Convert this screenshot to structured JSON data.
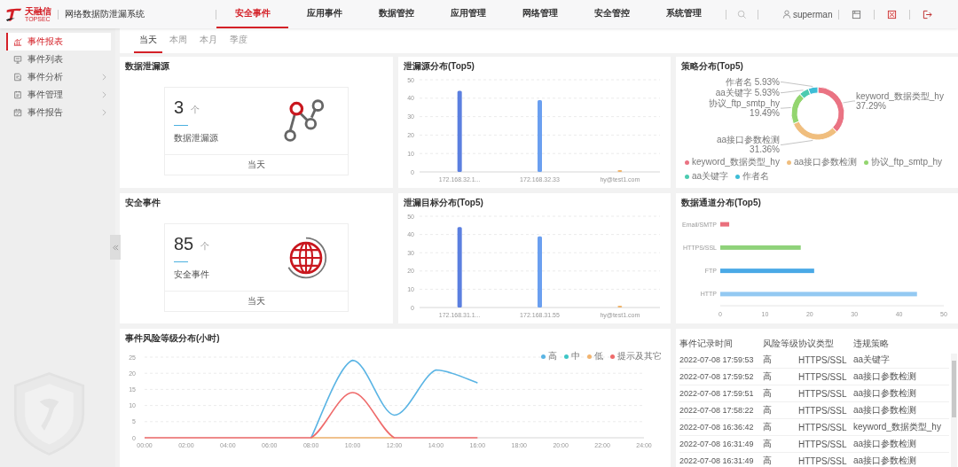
{
  "header": {
    "brand": "天融信",
    "brand_en": "TOPSEC",
    "system_name": "网络数据防泄漏系统",
    "nav": [
      {
        "label": "安全事件",
        "selected": true
      },
      {
        "label": "应用事件",
        "selected": false
      },
      {
        "label": "数据管控",
        "selected": false
      },
      {
        "label": "应用管理",
        "selected": false
      },
      {
        "label": "网络管理",
        "selected": false
      },
      {
        "label": "安全管控",
        "selected": false
      },
      {
        "label": "系统管理",
        "selected": false
      }
    ],
    "user": "superman"
  },
  "sidebar": {
    "items": [
      {
        "label": "事件报表",
        "selected": true,
        "expandable": false
      },
      {
        "label": "事件列表",
        "selected": false,
        "expandable": false
      },
      {
        "label": "事件分析",
        "selected": false,
        "expandable": true
      },
      {
        "label": "事件管理",
        "selected": false,
        "expandable": true
      },
      {
        "label": "事件报告",
        "selected": false,
        "expandable": true
      }
    ]
  },
  "period_tabs": [
    {
      "label": "当天",
      "selected": true
    },
    {
      "label": "本周",
      "selected": false
    },
    {
      "label": "本月",
      "selected": false
    },
    {
      "label": "季度",
      "selected": false
    }
  ],
  "stat_cards": [
    {
      "title": "数据泄漏源",
      "value": "3",
      "unit": "个",
      "label": "数据泄漏源",
      "footer": "当天"
    },
    {
      "title": "安全事件",
      "value": "85",
      "unit": "个",
      "label": "安全事件",
      "footer": "当天"
    }
  ],
  "leak_source": {
    "title": "泄漏源分布(Top5)",
    "chart_data": {
      "type": "bar",
      "categories": [
        "172.168.32.1...",
        "172.168.32.33",
        "hy@test1.com"
      ],
      "values": [
        44,
        39,
        1
      ],
      "colors": [
        "#5b7fe0",
        "#6a9ff0",
        "#f0b46a"
      ],
      "ylim": [
        0,
        50
      ],
      "yticks": [
        0,
        10,
        20,
        30,
        40,
        50
      ],
      "grid": true
    }
  },
  "policy": {
    "title": "策略分布(Top5)",
    "chart_data": {
      "type": "donut",
      "categories": [
        "keyword_数据类型_hy",
        "aa接口参数检测",
        "协议_ftp_smtp_hy",
        "aa关键字",
        "作者名"
      ],
      "values": [
        37.29,
        31.36,
        19.49,
        5.93,
        5.93
      ],
      "colors": [
        "#ea7383",
        "#f0be7e",
        "#93d56f",
        "#4ccbb0",
        "#3dbdd6"
      ],
      "value_labels": [
        "keyword_数据类型_hy 37.29%",
        "aa接口参数检测 31.36%",
        "协议_ftp_smtp_hy 19.49%",
        "aa关键字 5.93%",
        "作者名 5.93%"
      ]
    }
  },
  "leak_target": {
    "title": "泄漏目标分布(Top5)",
    "chart_data": {
      "type": "bar",
      "categories": [
        "172.168.31.1...",
        "172.168.31.55",
        "hy@test1.com"
      ],
      "values": [
        44,
        39,
        1
      ],
      "colors": [
        "#5b7fe0",
        "#6a9ff0",
        "#f0b46a"
      ],
      "ylim": [
        0,
        50
      ],
      "yticks": [
        0,
        10,
        20,
        30,
        40,
        50
      ],
      "grid": true
    }
  },
  "channel": {
    "title": "数据通道分布(Top5)",
    "chart_data": {
      "type": "bar",
      "orientation": "horizontal",
      "categories": [
        "Email/SMTP",
        "HTTPS/SSL",
        "FTP",
        "HTTP"
      ],
      "values": [
        2,
        18,
        21,
        44
      ],
      "colors": [
        "#ea6f7c",
        "#8fd27a",
        "#4aa9e6",
        "#93c9f2"
      ],
      "xlim": [
        0,
        50
      ],
      "xticks": [
        0,
        10,
        20,
        30,
        40,
        50
      ]
    }
  },
  "risk_hourly": {
    "title": "事件风险等级分布(小时)",
    "chart_data": {
      "type": "line",
      "categories": [
        "00:00",
        "02:00",
        "04:00",
        "06:00",
        "08:00",
        "10:00",
        "12:00",
        "14:00",
        "16:00",
        "18:00",
        "20:00",
        "22:00",
        "24:00"
      ],
      "ylim": [
        0,
        25
      ],
      "yticks": [
        0,
        5,
        10,
        15,
        20,
        25
      ],
      "grid": true,
      "series": [
        {
          "name": "高",
          "color": "#5ab4e4",
          "values": [
            null,
            null,
            null,
            null,
            0,
            24,
            7,
            21,
            17,
            null,
            null,
            null,
            null
          ]
        },
        {
          "name": "中",
          "color": "#3ec6c6",
          "values": [
            null,
            null,
            null,
            null,
            null,
            null,
            null,
            null,
            null,
            null,
            null,
            null,
            null
          ]
        },
        {
          "name": "低",
          "color": "#f2b36e",
          "values": [
            null,
            null,
            null,
            null,
            0,
            0,
            0,
            null,
            null,
            null,
            null,
            null,
            null
          ]
        },
        {
          "name": "提示及其它",
          "color": "#ef6b6b",
          "values": [
            0,
            0,
            0,
            0,
            0,
            14,
            0,
            0,
            0,
            null,
            null,
            null,
            null
          ]
        }
      ]
    }
  },
  "event_table": {
    "columns": [
      "事件记录时间",
      "风险等级",
      "协议类型",
      "违规策略"
    ],
    "rows": [
      [
        "2022-07-08 17:59:53",
        "高",
        "HTTPS/SSL",
        "aa关键字"
      ],
      [
        "2022-07-08 17:59:52",
        "高",
        "HTTPS/SSL",
        "aa接口参数检测"
      ],
      [
        "2022-07-08 17:59:51",
        "高",
        "HTTPS/SSL",
        "aa接口参数检测"
      ],
      [
        "2022-07-08 17:58:22",
        "高",
        "HTTPS/SSL",
        "aa接口参数检测"
      ],
      [
        "2022-07-08 16:36:42",
        "高",
        "HTTPS/SSL",
        "keyword_数据类型_hy"
      ],
      [
        "2022-07-08 16:31:49",
        "高",
        "HTTPS/SSL",
        "aa接口参数检测"
      ],
      [
        "2022-07-08 16:31:49",
        "高",
        "HTTPS/SSL",
        "aa接口参数检测"
      ]
    ]
  }
}
